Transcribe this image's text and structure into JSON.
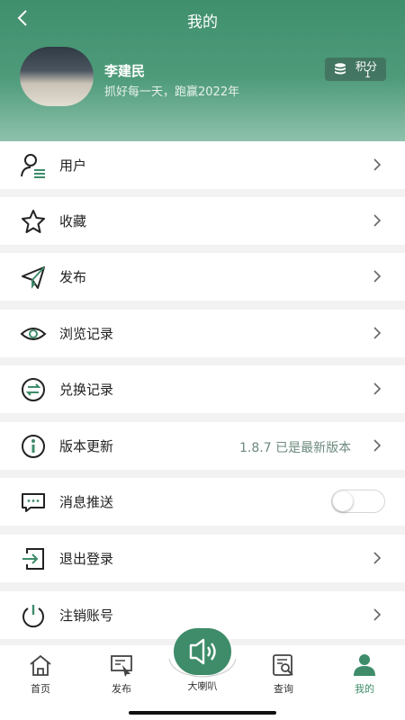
{
  "header": {
    "title": "我的",
    "back_icon": "chevron-left-icon"
  },
  "profile": {
    "name": "李建民",
    "motto": "抓好每一天，跑赢2022年",
    "points_label": "积分",
    "points_value": "1"
  },
  "menu": [
    {
      "label": "用户",
      "icon": "user-list-icon"
    },
    {
      "label": "收藏",
      "icon": "star-icon"
    },
    {
      "label": "发布",
      "icon": "send-icon"
    },
    {
      "label": "浏览记录",
      "icon": "eye-icon"
    },
    {
      "label": "兑换记录",
      "icon": "exchange-icon"
    },
    {
      "label": "版本更新",
      "icon": "info-icon",
      "value": "1.8.7 已是最新版本"
    },
    {
      "label": "消息推送",
      "icon": "message-icon",
      "toggle": false
    },
    {
      "label": "退出登录",
      "icon": "logout-icon"
    },
    {
      "label": "注销账号",
      "icon": "power-icon"
    }
  ],
  "tabbar": {
    "home": "首页",
    "publish": "发布",
    "center": "大喇叭",
    "query": "查询",
    "mine": "我的"
  },
  "colors": {
    "brand": "#3e8c6a",
    "header_top": "#3f8f6d",
    "header_bottom": "#8fc2ad"
  }
}
